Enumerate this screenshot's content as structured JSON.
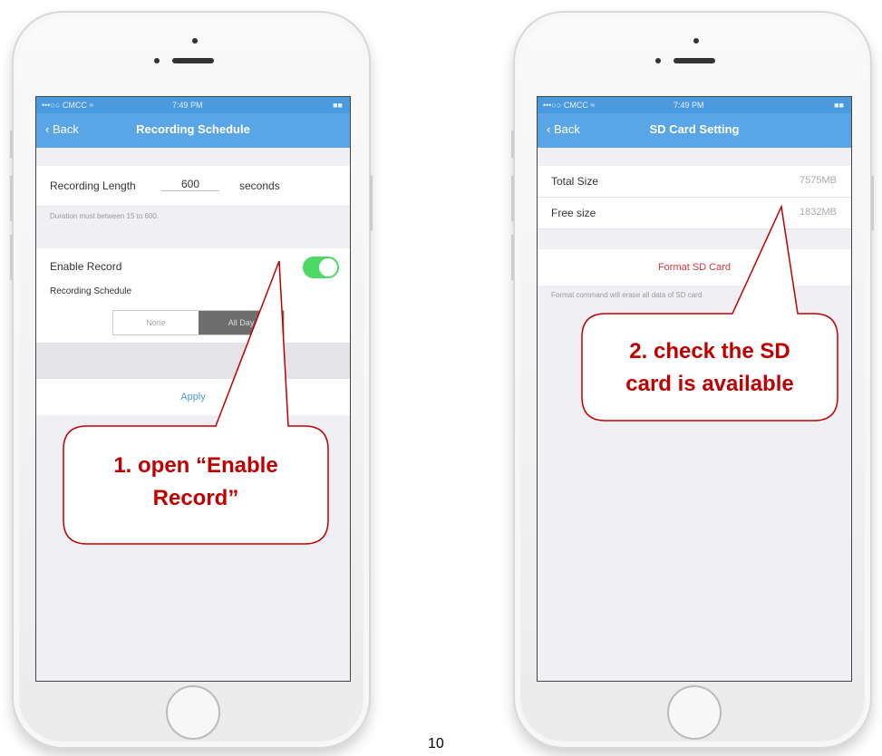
{
  "screen1": {
    "status": {
      "carrier": "•••○○ CMCC ≈",
      "time": "7:49 PM",
      "battery": "■■"
    },
    "nav": {
      "back": "Back",
      "title": "Recording Schedule"
    },
    "recording_length": {
      "label": "Recording Length",
      "value": "600",
      "unit": "seconds"
    },
    "hint": "Duration must between 15 to 600.",
    "enable_record": {
      "label": "Enable Record",
      "on": true
    },
    "schedule_label": "Recording Schedule",
    "segments": [
      "None",
      "All Day"
    ],
    "apply": "Apply"
  },
  "screen2": {
    "status": {
      "carrier": "•••○○ CMCC ≈",
      "time": "7:49 PM",
      "battery": "■■"
    },
    "nav": {
      "back": "Back",
      "title": "SD Card Setting"
    },
    "rows": [
      {
        "label": "Total Size",
        "value": "7575MB"
      },
      {
        "label": "Free size",
        "value": "1832MB"
      }
    ],
    "format": "Format SD Card",
    "hint": "Format command will erase all data of SD card"
  },
  "callouts": {
    "callout1": {
      "line1": "1. open “Enable",
      "line2": "Record”"
    },
    "callout2": {
      "line1": "2. check the SD",
      "line2": "card is available"
    }
  },
  "page_number": "10",
  "colors": {
    "accent": "#5aa5e6",
    "callout": "#c00000",
    "toggle": "#4cd964"
  }
}
